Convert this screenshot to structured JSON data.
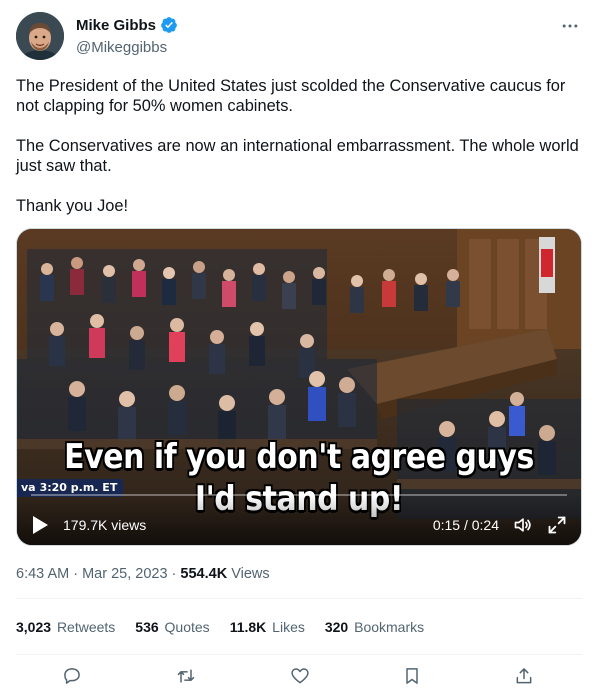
{
  "author": {
    "display_name": "Mike Gibbs",
    "handle": "@Mikeggibbs",
    "verified": true
  },
  "tweet": {
    "paragraphs": [
      "The President of the United States just scolded the Conservative caucus for not clapping for 50% women cabinets.",
      "The Conservatives are now an international embarrassment. The whole world just saw that.",
      "Thank you Joe!"
    ]
  },
  "video": {
    "caption_line1": "Even if you don't agree guys",
    "caption_line2": "I'd stand up!",
    "lower_third_prefix": "va",
    "lower_third_time": "3:20 p.m. ET",
    "views": "179.7K views",
    "time": "0:15 / 0:24",
    "progress_fraction": 0.625
  },
  "meta": {
    "timestamp": "6:43 AM · Mar 25, 2023 · ",
    "views_count": "554.4K",
    "views_label": " Views"
  },
  "stats": {
    "retweets_count": "3,023",
    "retweets_label": "Retweets",
    "quotes_count": "536",
    "quotes_label": "Quotes",
    "likes_count": "11.8K",
    "likes_label": "Likes",
    "bookmarks_count": "320",
    "bookmarks_label": "Bookmarks"
  },
  "colors": {
    "text_primary": "#0f1419",
    "text_secondary": "#536471",
    "verified": "#1d9bf0",
    "divider": "#eff3f4"
  },
  "icons": {
    "more": "more-dots-icon",
    "verified": "verified-badge-icon",
    "play": "play-icon",
    "volume": "volume-icon",
    "fullscreen": "fullscreen-icon",
    "reply": "reply-icon",
    "retweet": "retweet-icon",
    "like": "heart-icon",
    "bookmark": "bookmark-icon",
    "share": "share-icon"
  }
}
